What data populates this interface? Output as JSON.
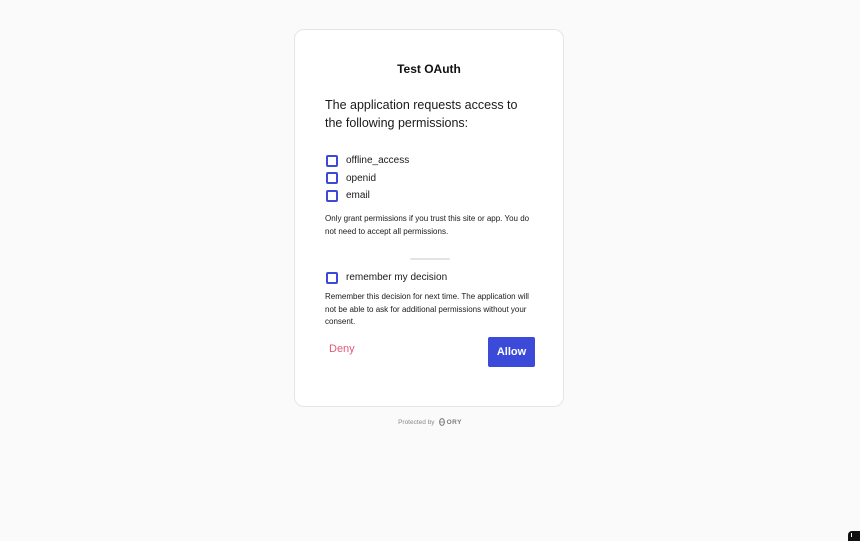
{
  "app": {
    "title": "Test OAuth"
  },
  "consent": {
    "prompt": "The application requests access to the following permissions:",
    "permissions": [
      {
        "label": "offline_access",
        "checked": false
      },
      {
        "label": "openid",
        "checked": false
      },
      {
        "label": "email",
        "checked": false
      }
    ],
    "grant_note": "Only grant permissions if you trust this site or app. You do not need to accept all permissions.",
    "remember_label": "remember my decision",
    "remember_checked": false,
    "remember_note": "Remember this decision for next time. The application will not be able to ask for additional permissions without your consent."
  },
  "actions": {
    "deny_label": "Deny",
    "allow_label": "Allow"
  },
  "footer": {
    "protected_by": "Protected by",
    "brand": "ORY",
    "brand_icon": "ory-logo-icon"
  },
  "colors": {
    "accent": "#3b4ad8",
    "deny": "#e05a7a",
    "background": "#fafafa",
    "card": "#ffffff"
  }
}
